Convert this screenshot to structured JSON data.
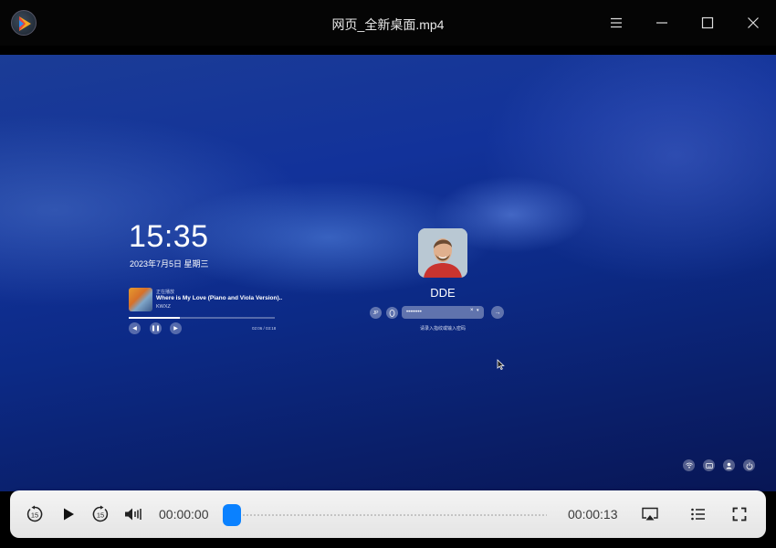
{
  "window": {
    "title": "网页_全新桌面.mp4"
  },
  "titlebar_icons": {
    "logo": "player-logo-icon",
    "menu": "menu-icon",
    "minimize": "minimize-icon",
    "maximize": "maximize-icon",
    "close": "close-icon"
  },
  "lockscreen": {
    "time": "15:35",
    "date": "2023年7月5日 星期三",
    "music": {
      "tag": "正在播放",
      "song": "Where is My Love (Piano and Viola Version)..",
      "artist": "KWXZ",
      "time": "02:06 / 03:18",
      "progress": 0.35
    },
    "user": {
      "name": "DDE",
      "keyboard_layout": "JP",
      "password_mask": "••••••••",
      "hint": "请录入指纹或输入密码"
    },
    "tray_icons": [
      "wifi-icon",
      "keyboard-icon",
      "user-icon",
      "power-icon"
    ]
  },
  "controls": {
    "rewind_label": "15",
    "forward_label": "15",
    "current_time": "00:00:00",
    "total_time": "00:00:13",
    "progress": 0.0,
    "icons": [
      "rewind-15-icon",
      "play-icon",
      "forward-15-icon",
      "volume-icon",
      "screen-cast-icon",
      "playlist-icon",
      "fullscreen-icon"
    ]
  },
  "colors": {
    "accent": "#0a81ff",
    "titlebar": "#050505",
    "control_bar": "#eeeeee"
  }
}
